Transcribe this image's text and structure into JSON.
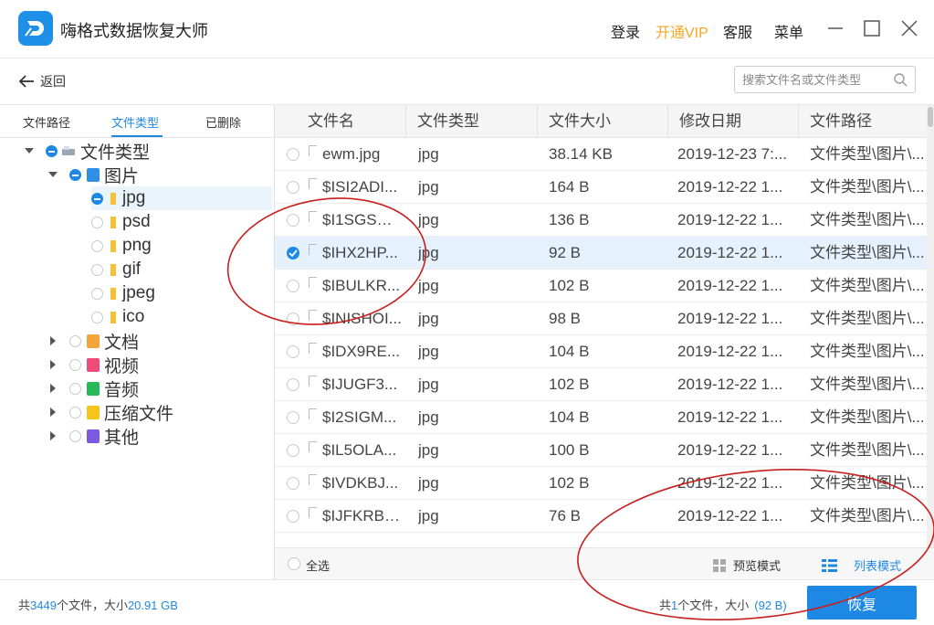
{
  "window": {
    "title": "嗨格式数据恢复大师",
    "login": "登录",
    "vip": "开通VIP",
    "service": "客服",
    "menu": "菜单"
  },
  "toolbar": {
    "back_label": "返回",
    "search_placeholder": "搜索文件名或文件类型"
  },
  "left_tabs": [
    "文件路径",
    "文件类型",
    "已删除"
  ],
  "left_tabs_active": "文件类型",
  "tree": {
    "root": "文件类型",
    "images": "图片",
    "image_types": [
      "jpg",
      "psd",
      "png",
      "gif",
      "jpeg",
      "ico"
    ],
    "selected": "jpg",
    "others": [
      "文档",
      "视频",
      "音频",
      "压缩文件",
      "其他"
    ]
  },
  "table": {
    "columns": [
      "文件名",
      "文件类型",
      "文件大小",
      "修改日期",
      "文件路径"
    ],
    "rows": [
      {
        "name": "ewm.jpg",
        "type": "jpg",
        "size": "38.14 KB",
        "date": "2019-12-23 7:...",
        "path": "文件类型\\图片\\..."
      },
      {
        "name": "$ISI2ADI...",
        "type": "jpg",
        "size": "164 B",
        "date": "2019-12-22 1...",
        "path": "文件类型\\图片\\..."
      },
      {
        "name": "$I1SGSW...",
        "type": "jpg",
        "size": "136 B",
        "date": "2019-12-22 1...",
        "path": "文件类型\\图片\\..."
      },
      {
        "name": "$IHX2HP...",
        "type": "jpg",
        "size": "92 B",
        "date": "2019-12-22 1...",
        "path": "文件类型\\图片\\...",
        "checked": true
      },
      {
        "name": "$IBULKR...",
        "type": "jpg",
        "size": "102 B",
        "date": "2019-12-22 1...",
        "path": "文件类型\\图片\\..."
      },
      {
        "name": "$INISHOI...",
        "type": "jpg",
        "size": "98 B",
        "date": "2019-12-22 1...",
        "path": "文件类型\\图片\\..."
      },
      {
        "name": "$IDX9RE...",
        "type": "jpg",
        "size": "104 B",
        "date": "2019-12-22 1...",
        "path": "文件类型\\图片\\..."
      },
      {
        "name": "$IJUGF3...",
        "type": "jpg",
        "size": "102 B",
        "date": "2019-12-22 1...",
        "path": "文件类型\\图片\\..."
      },
      {
        "name": "$I2SIGM...",
        "type": "jpg",
        "size": "104 B",
        "date": "2019-12-22 1...",
        "path": "文件类型\\图片\\..."
      },
      {
        "name": "$IL5OLA...",
        "type": "jpg",
        "size": "100 B",
        "date": "2019-12-22 1...",
        "path": "文件类型\\图片\\..."
      },
      {
        "name": "$IVDKBJ...",
        "type": "jpg",
        "size": "102 B",
        "date": "2019-12-22 1...",
        "path": "文件类型\\图片\\..."
      },
      {
        "name": "$IJFKRBR...",
        "type": "jpg",
        "size": "76 B",
        "date": "2019-12-22 1...",
        "path": "文件类型\\图片\\..."
      }
    ]
  },
  "footer": {
    "select_all": "全选",
    "preview_mode": "预览模式",
    "list_mode": "列表模式"
  },
  "status": {
    "total_prefix": "共",
    "total_count": "3449",
    "total_mid": "个文件，大小",
    "total_size": "20.91 GB",
    "sel_prefix": "共",
    "sel_count": "1",
    "sel_mid": "个文件，大小",
    "sel_size": "(92 B)",
    "recover_label": "恢复"
  },
  "colors": {
    "accent": "#1e88e5",
    "vip": "#f5a623",
    "annotation": "#c81e1e"
  }
}
